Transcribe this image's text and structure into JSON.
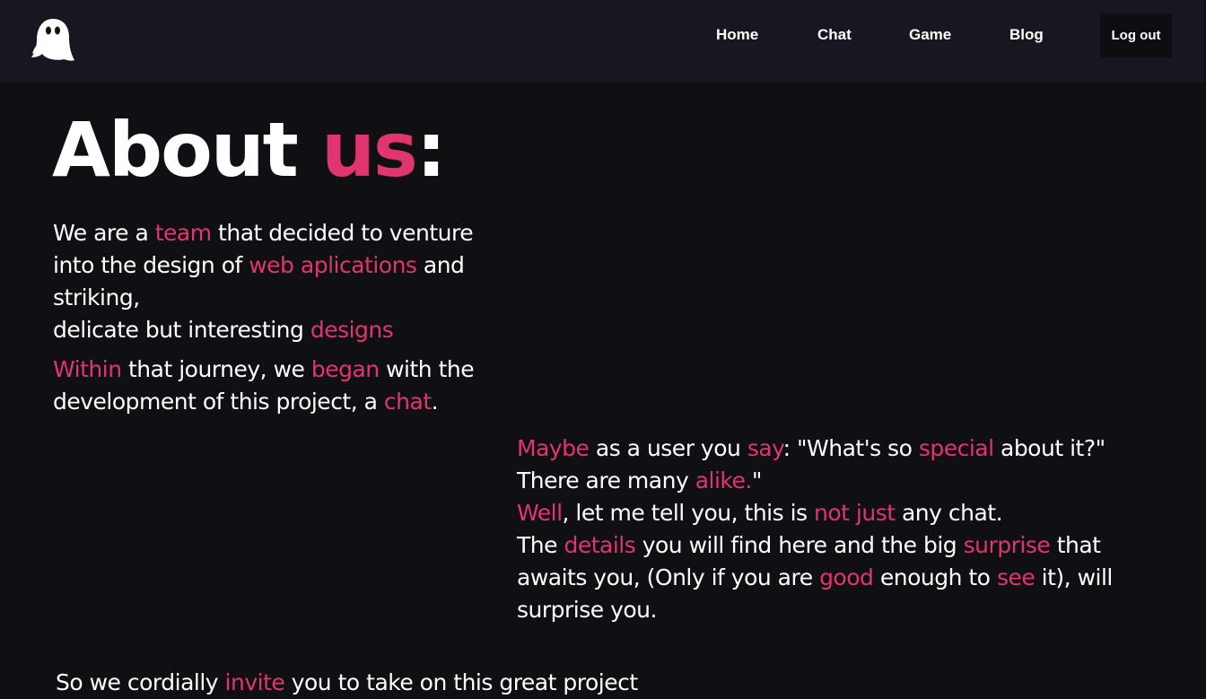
{
  "nav": {
    "links": [
      "Home",
      "Chat",
      "Game",
      "Blog"
    ],
    "logout_label": "Log out",
    "logo_icon": "ghost-icon"
  },
  "colors": {
    "accent": "#e0356f",
    "background": "#0f0f14",
    "navbar": "#171722",
    "text": "#ffffff"
  },
  "heading": {
    "word1": "About",
    "word2": "us",
    "colon": ":"
  },
  "intro": {
    "line1": [
      "We are a ",
      "team",
      " that decided to venture"
    ],
    "line2": [
      "into the design of ",
      "web aplications",
      " and"
    ],
    "line3": "striking,",
    "line4": [
      "delicate but interesting ",
      "designs"
    ]
  },
  "journey": {
    "line1": [
      "Within",
      " that journey, we ",
      "began",
      " with the"
    ],
    "line2": [
      "development of this project, a ",
      "chat",
      "."
    ]
  },
  "special": {
    "line1": [
      "Maybe",
      " as a user you ",
      "say",
      ": \"What's so ",
      "special",
      " about it?\""
    ],
    "line2": [
      "There are many ",
      "alike.",
      "\""
    ],
    "line3": [
      "Well",
      ", let me tell you, this is ",
      "not just",
      " any chat."
    ],
    "line4": [
      "The ",
      "details",
      " you will find here and the big ",
      "surprise",
      " that"
    ],
    "line5": [
      "awaits you, (Only if you are ",
      "good",
      " enough to ",
      "see",
      " it), will"
    ],
    "line6": "surprise you."
  },
  "footer_partial": [
    "So we cordially ",
    "invite",
    " you to take on this great project"
  ]
}
